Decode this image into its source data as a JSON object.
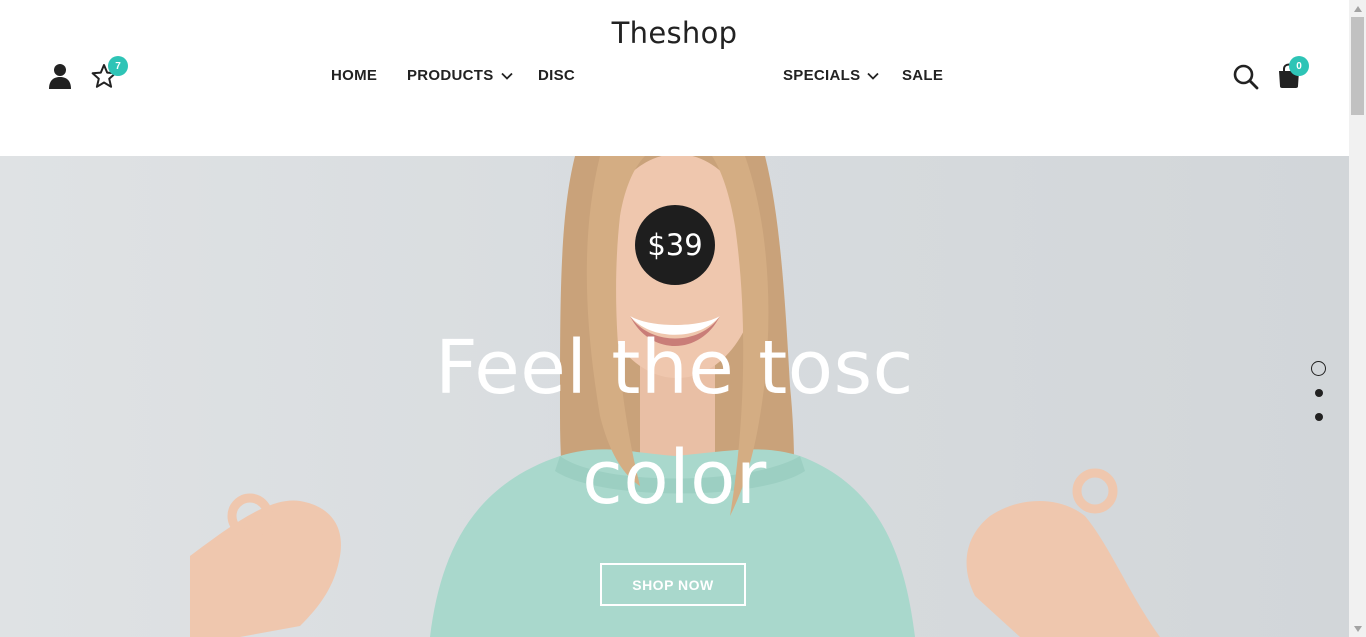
{
  "brand": {
    "name": "Theshop"
  },
  "header": {
    "wishlist_count": "7",
    "cart_count": "0",
    "accent_color": "#2ec4b6"
  },
  "nav": {
    "items": [
      {
        "label": "HOME"
      },
      {
        "label": "PRODUCTS"
      },
      {
        "label": "DISC"
      },
      {
        "label": "SPECIALS"
      },
      {
        "label": "SALE"
      }
    ]
  },
  "icons": {
    "account": "user-icon",
    "wishlist": "star-icon",
    "search": "search-icon",
    "cart": "shopping-bag-icon"
  },
  "hero": {
    "price": "$39",
    "headline_line1": "Feel the tosc",
    "headline_line2": "color",
    "cta_label": "SHOP NOW",
    "slides_total": 3,
    "active_slide": 1
  }
}
